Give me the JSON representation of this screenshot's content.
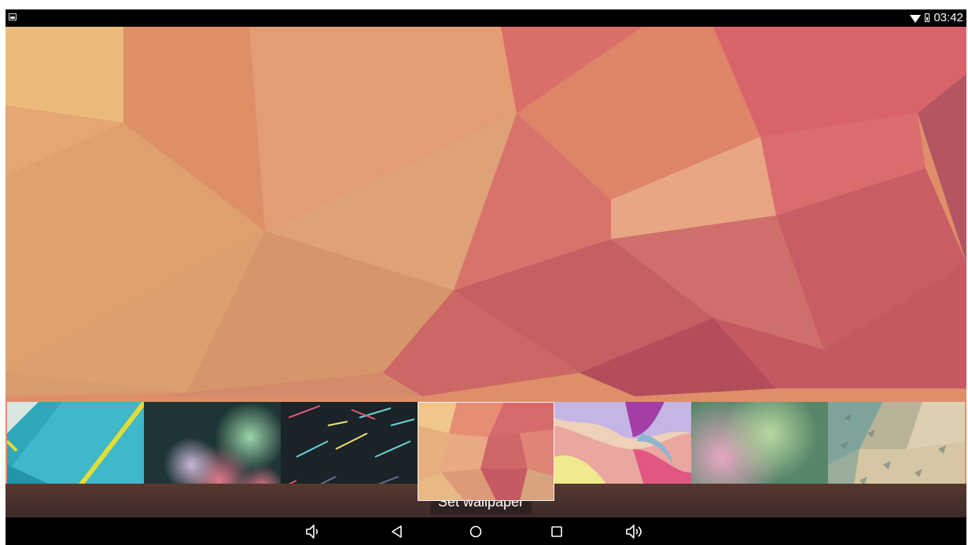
{
  "status_bar": {
    "time": "03:42",
    "left_icon": "gallery-notification-icon",
    "icons": [
      "wifi-icon",
      "battery-icon"
    ]
  },
  "wallpaper_picker": {
    "thumbnails": [
      {
        "name": "teal-diagonal-stripe",
        "selected": false
      },
      {
        "name": "dark-bokeh",
        "selected": false
      },
      {
        "name": "dark-neon-lines",
        "selected": false
      },
      {
        "name": "warm-polygon",
        "selected": true
      },
      {
        "name": "pastel-waves",
        "selected": false
      },
      {
        "name": "pink-green-blur",
        "selected": false
      },
      {
        "name": "sand-texture",
        "selected": false
      }
    ],
    "set_wallpaper_label": "Set wallpaper"
  },
  "navigation_bar": {
    "buttons": [
      "volume-down-icon",
      "back-icon",
      "home-icon",
      "recents-icon",
      "volume-up-icon"
    ]
  }
}
